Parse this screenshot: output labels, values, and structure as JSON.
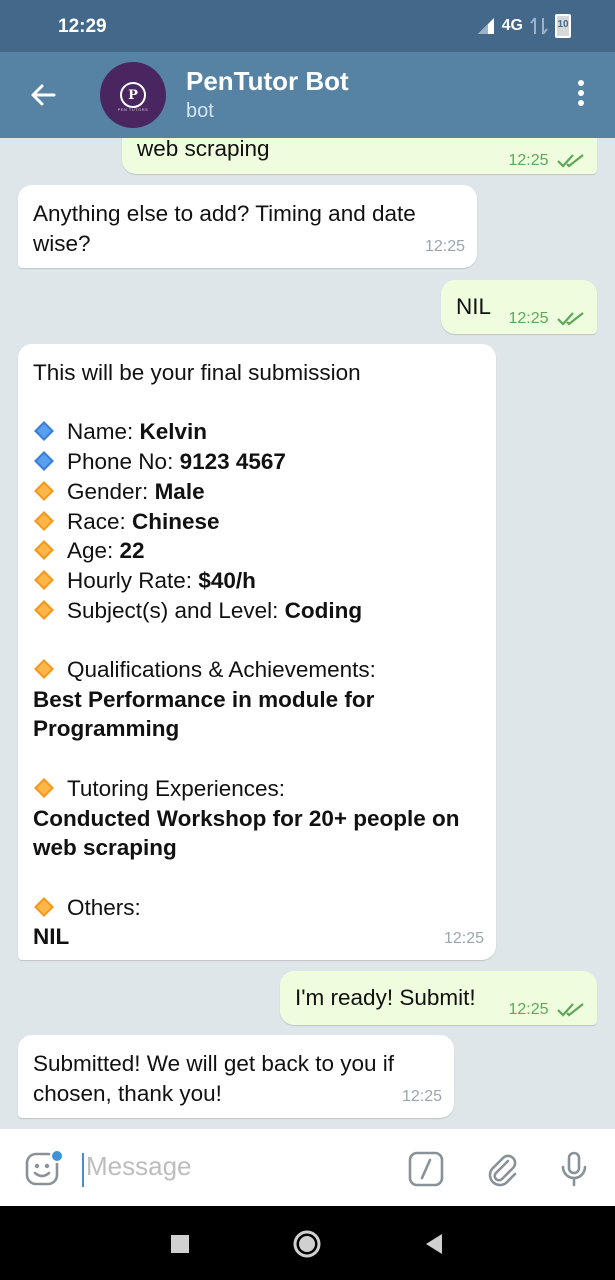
{
  "status_bar": {
    "time": "12:29",
    "network": "4G",
    "battery": "10"
  },
  "header": {
    "title": "PenTutor Bot",
    "subtitle": "bot",
    "avatar_letter": "P",
    "avatar_caption": "PEN TUTORS",
    "back_icon": "back-arrow-icon",
    "menu_icon": "more-vertical-icon"
  },
  "messages": [
    {
      "from": "me",
      "text": "web scraping",
      "time": "12:25"
    },
    {
      "from": "bot",
      "text": "Anything else to add? Timing and date wise?",
      "time": "12:25"
    },
    {
      "from": "me",
      "text": "NIL",
      "time": "12:25"
    },
    {
      "from": "bot",
      "intro": "This will be your final submission",
      "fields": [
        {
          "icon": "blue-diamond",
          "label": "Name: ",
          "value": "Kelvin"
        },
        {
          "icon": "blue-diamond",
          "label": "Phone No: ",
          "value": "9123 4567"
        },
        {
          "icon": "orange-diamond",
          "label": "Gender: ",
          "value": "Male"
        },
        {
          "icon": "orange-diamond",
          "label": "Race: ",
          "value": "Chinese"
        },
        {
          "icon": "orange-diamond",
          "label": "Age: ",
          "value": "22"
        },
        {
          "icon": "orange-diamond",
          "label": "Hourly Rate: ",
          "value": "$40/h"
        },
        {
          "icon": "orange-diamond",
          "label": "Subject(s) and Level: ",
          "value": "Coding"
        }
      ],
      "qualifications_label": "Qualifications & Achievements:",
      "qualifications_value": "Best Performance in module for Programming",
      "experience_label": "Tutoring Experiences:",
      "experience_value": "Conducted Workshop for 20+ people on web scraping",
      "others_label": "Others:",
      "others_value": "NIL",
      "time": "12:25"
    },
    {
      "from": "me",
      "text": "I'm ready! Submit!",
      "time": "12:25"
    },
    {
      "from": "bot",
      "text": "Submitted! We will get back to you if chosen, thank you!",
      "time": "12:25"
    }
  ],
  "input": {
    "placeholder": "Message",
    "icons": [
      "emoji-icon",
      "bot-command-icon",
      "attach-icon",
      "microphone-icon"
    ]
  },
  "colors": {
    "status_bar": "#44688a",
    "header": "#5682a3",
    "chat_bg": "#dfe6ea",
    "outgoing_bubble": "#effdde",
    "incoming_bubble": "#ffffff",
    "read_check": "#5ea85b",
    "blue_diamond": "#3a7fd9",
    "orange_diamond": "#f39a1e"
  }
}
